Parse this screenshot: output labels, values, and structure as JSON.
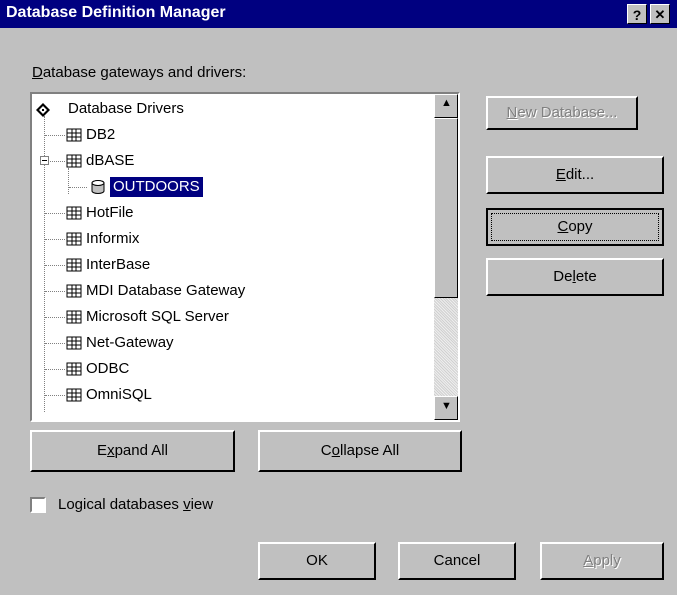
{
  "window": {
    "title": "Database Definition Manager",
    "help_glyph": "?",
    "close_glyph": "✕"
  },
  "gateways_label": {
    "pre": "",
    "accel": "D",
    "post": "atabase gateways and drivers:"
  },
  "tree": {
    "root": {
      "label": "Database Drivers",
      "icon": "drivers-root-icon"
    },
    "items": [
      {
        "label": "DB2",
        "icon": "driver-icon"
      },
      {
        "label": "dBASE",
        "icon": "driver-icon",
        "expanded": true
      },
      {
        "label": "OUTDOORS",
        "icon": "database-cylinder-icon",
        "selected": true
      },
      {
        "label": "HotFile",
        "icon": "driver-icon"
      },
      {
        "label": "Informix",
        "icon": "driver-icon"
      },
      {
        "label": "InterBase",
        "icon": "driver-icon"
      },
      {
        "label": "MDI Database Gateway",
        "icon": "driver-icon"
      },
      {
        "label": "Microsoft SQL Server",
        "icon": "driver-icon"
      },
      {
        "label": "Net-Gateway",
        "icon": "driver-icon"
      },
      {
        "label": "ODBC",
        "icon": "driver-icon"
      },
      {
        "label": "OmniSQL",
        "icon": "driver-icon"
      }
    ],
    "scroll_up_glyph": "▲",
    "scroll_down_glyph": "▼"
  },
  "buttons": {
    "new_database": {
      "pre": "",
      "accel": "N",
      "post": "ew Database...",
      "enabled": false
    },
    "edit": {
      "pre": "",
      "accel": "E",
      "post": "dit...",
      "enabled": true
    },
    "copy": {
      "pre": "",
      "accel": "C",
      "post": "opy",
      "enabled": true,
      "focused": true
    },
    "delete": {
      "pre": "De",
      "accel": "l",
      "post": "ete",
      "enabled": true
    },
    "expand_all": {
      "pre": "E",
      "accel": "x",
      "post": "pand All",
      "enabled": true
    },
    "collapse_all": {
      "pre": "C",
      "accel": "o",
      "post": "llapse All",
      "enabled": true
    },
    "ok": {
      "label": "OK",
      "enabled": true
    },
    "cancel": {
      "label": "Cancel",
      "enabled": true
    },
    "apply": {
      "pre": "",
      "accel": "A",
      "post": "pply",
      "enabled": false
    }
  },
  "logical_view": {
    "pre": "Logical databases ",
    "accel": "v",
    "post": "iew",
    "checked": false
  }
}
